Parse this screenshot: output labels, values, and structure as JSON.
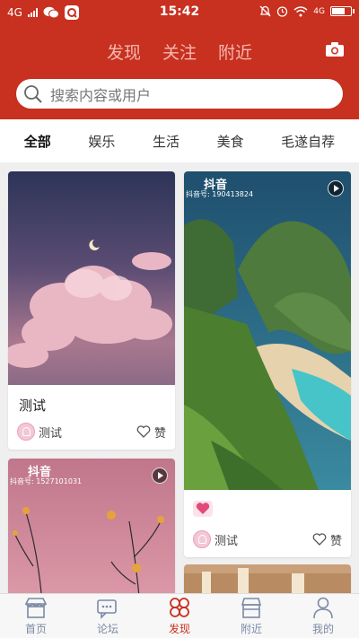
{
  "status_bar": {
    "network_left": "4G",
    "time": "15:42",
    "network_right": "4G",
    "battery_level": 0.75
  },
  "header": {
    "tabs": [
      "发现",
      "关注",
      "附近"
    ],
    "active_tab": 0,
    "camera_icon": "camera-icon"
  },
  "search": {
    "placeholder": "搜索内容或用户"
  },
  "categories": [
    "全部",
    "娱乐",
    "生活",
    "美食",
    "毛遂自荐"
  ],
  "feed": {
    "card1": {
      "title": "测试",
      "author": "测试",
      "like_label": "赞"
    },
    "card2": {
      "watermark": "抖音",
      "watermark_id": "抖音号: 190413824",
      "author": "测试",
      "like_label": "赞"
    },
    "card3": {
      "watermark": "抖音",
      "watermark_id": "抖音号: 1527101031"
    }
  },
  "nav": {
    "items": [
      "首页",
      "论坛",
      "发现",
      "附近",
      "我的"
    ],
    "active": 2
  },
  "colors": {
    "brand_red": "#c8301f",
    "nav_inactive": "#7a8aa5"
  }
}
